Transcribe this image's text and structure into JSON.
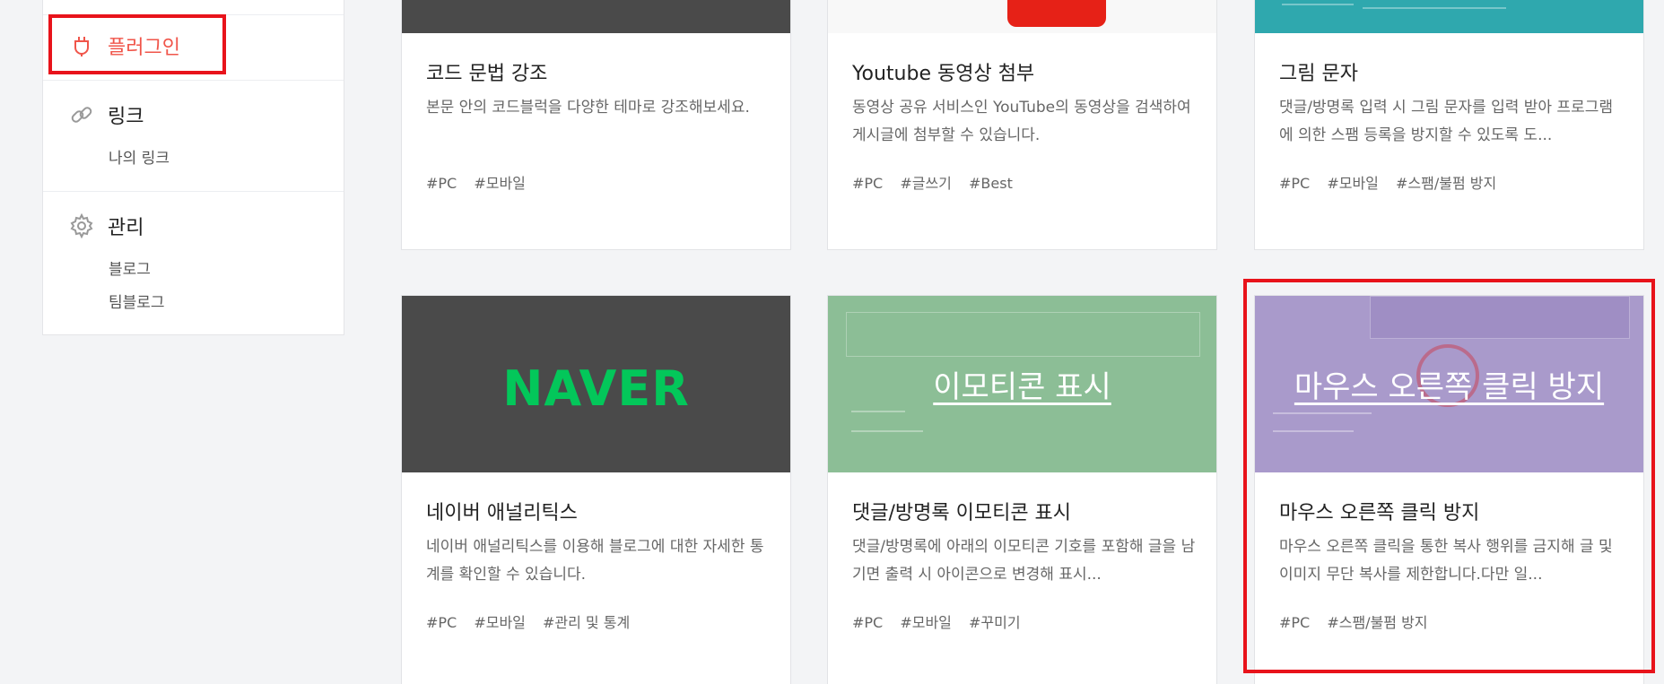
{
  "sidebar": {
    "plugin": {
      "label": "플러그인",
      "icon": "plug-icon"
    },
    "link": {
      "label": "링크",
      "icon": "link-icon",
      "items": [
        {
          "label": "나의 링크"
        }
      ]
    },
    "manage": {
      "label": "관리",
      "icon": "gear-icon",
      "items": [
        {
          "label": "블로그"
        },
        {
          "label": "팀블로그"
        }
      ]
    }
  },
  "cards": [
    {
      "title": "코드 문법 강조",
      "desc": "본문 안의 코드블럭을 다양한 테마로 강조해보세요.",
      "tags": [
        "#PC",
        "#모바일"
      ]
    },
    {
      "title": "Youtube 동영상 첨부",
      "desc": "동영상 공유 서비스인 YouTube의 동영상을 검색하여 게시글에 첨부할 수 있습니다.",
      "tags": [
        "#PC",
        "#글쓰기",
        "#Best"
      ]
    },
    {
      "title": "그림 문자",
      "desc": "댓글/방명록 입력 시 그림 문자를 입력 받아 프로그램에 의한 스팸 등록을 방지할 수 있도록 도...",
      "tags": [
        "#PC",
        "#모바일",
        "#스팸/불펌 방지"
      ]
    },
    {
      "title": "네이버 애널리틱스",
      "desc": "네이버 애널리틱스를 이용해 블로그에 대한 자세한 통계를 확인할 수 있습니다.",
      "tags": [
        "#PC",
        "#모바일",
        "#관리 및 통계"
      ],
      "thumb_logo": "NAVER"
    },
    {
      "title": "댓글/방명록 이모티콘 표시",
      "desc": "댓글/방명록에 아래의 이모티콘 기호를 포함해 글을 남기면 출력 시 아이콘으로 변경해 표시...",
      "tags": [
        "#PC",
        "#모바일",
        "#꾸미기"
      ],
      "thumb_overlay": "이모티콘 표시"
    },
    {
      "title": "마우스 오른쪽 클릭 방지",
      "desc": "마우스 오른쪽 클릭을 통한 복사 행위를 금지해 글 및 이미지 무단 복사를 제한합니다.다만 일...",
      "tags": [
        "#PC",
        "#스팸/불펌 방지"
      ],
      "thumb_overlay": "마우스 오른쪽 클릭 방지"
    }
  ],
  "colors": {
    "accent": "#f0554a",
    "highlight": "#e8131b",
    "naver_green": "#03c75a"
  }
}
